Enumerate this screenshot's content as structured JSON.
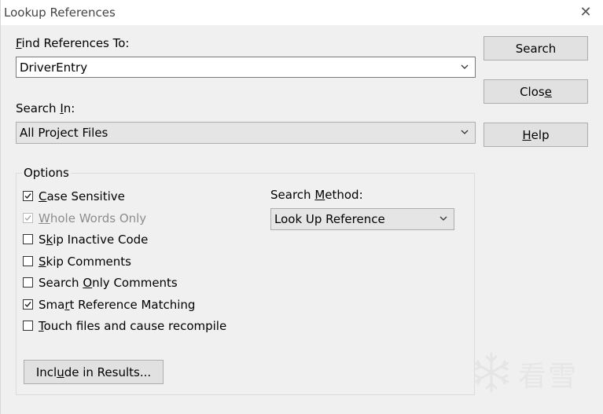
{
  "window": {
    "title": "Lookup References",
    "close_glyph": "✕"
  },
  "find": {
    "label_accel": "F",
    "label_rest": "ind References To:",
    "value": "DriverEntry"
  },
  "search_in": {
    "label_pre": "Search ",
    "label_accel": "I",
    "label_rest": "n:",
    "value": "All Project Files"
  },
  "buttons": {
    "search": "Search",
    "close_pre": "Clos",
    "close_accel": "e",
    "help_accel": "H",
    "help_rest": "elp",
    "include_pre": "Incl",
    "include_accel": "u",
    "include_rest": "de in Results..."
  },
  "options": {
    "group_title": "Options",
    "items": [
      {
        "pre": "",
        "accel": "C",
        "rest": "ase Sensitive",
        "checked": true,
        "disabled": false
      },
      {
        "pre": "",
        "accel": "W",
        "rest": "hole Words Only",
        "checked": true,
        "disabled": true
      },
      {
        "pre": "S",
        "accel": "k",
        "rest": "ip Inactive Code",
        "checked": false,
        "disabled": false
      },
      {
        "pre": "",
        "accel": "S",
        "rest": "kip Comments",
        "checked": false,
        "disabled": false
      },
      {
        "pre": "Search ",
        "accel": "O",
        "rest": "nly Comments",
        "checked": false,
        "disabled": false
      },
      {
        "pre": "Sma",
        "accel": "r",
        "rest": "t Reference Matching",
        "checked": true,
        "disabled": false
      },
      {
        "pre": "",
        "accel": "T",
        "rest": "ouch files and cause recompile",
        "checked": false,
        "disabled": false
      }
    ]
  },
  "search_method": {
    "label_pre": "Search ",
    "label_accel": "M",
    "label_rest": "ethod:",
    "value": "Look Up Reference"
  },
  "watermark": {
    "text": "看雪"
  },
  "icons": {
    "dropdown": "chevron-down-icon",
    "check": "checkmark-icon",
    "close": "close-icon",
    "logo": "snowflake-logo-icon"
  }
}
